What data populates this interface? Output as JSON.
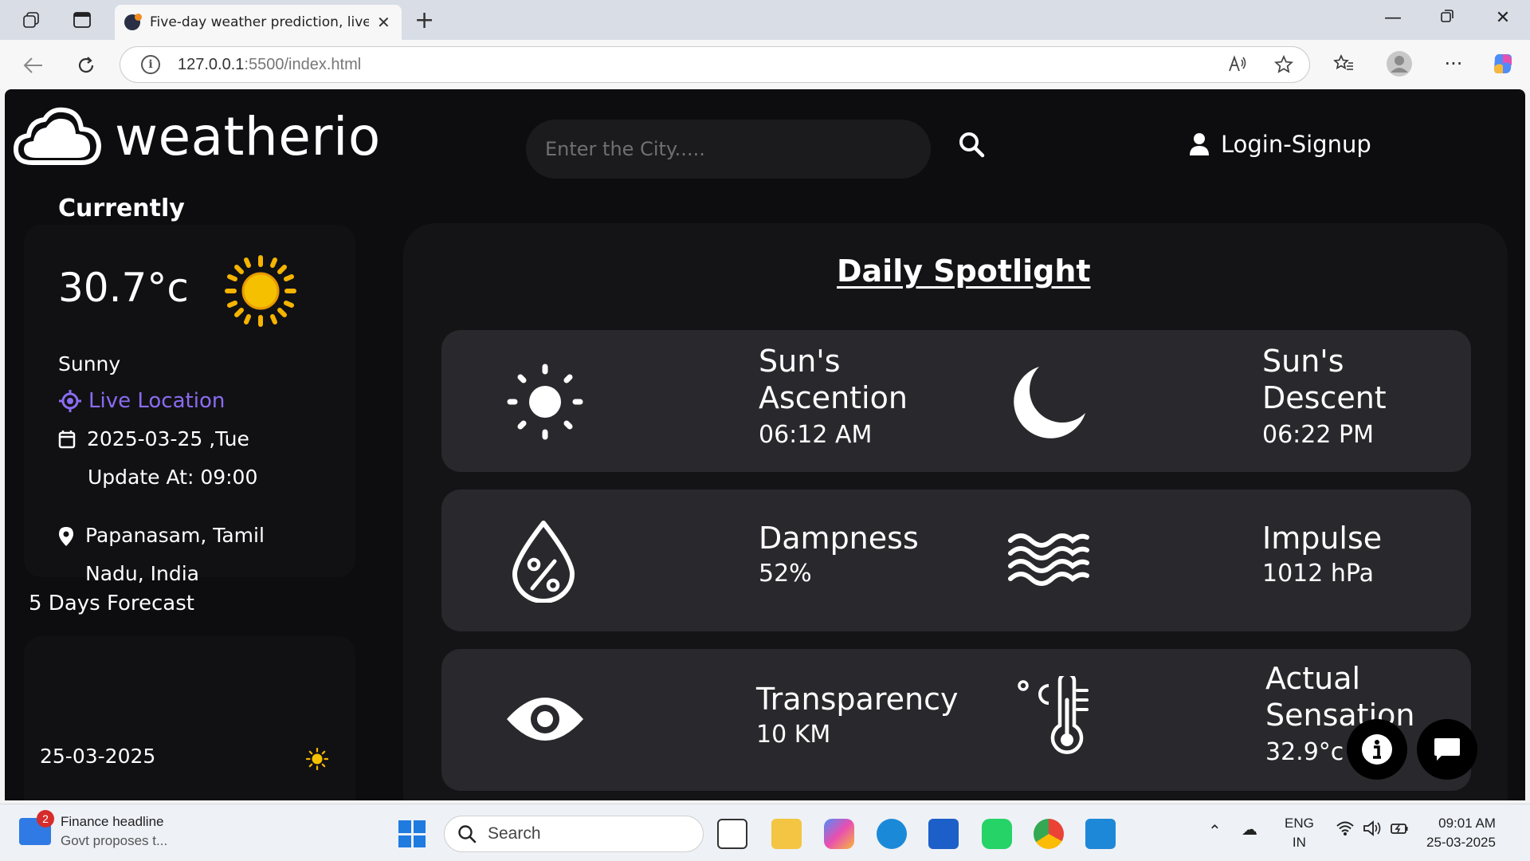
{
  "browser": {
    "tab_title": "Five-day weather prediction, live w",
    "url_host": "127.0.0.1",
    "url_path": ":5500/index.html"
  },
  "header": {
    "logo_text": "weatherio",
    "search_placeholder": "Enter the City.....",
    "login_label": "Login-Signup"
  },
  "current": {
    "title": "Currently",
    "temperature": "30.7°c",
    "condition": "Sunny",
    "live_location_label": "Live Location",
    "date": "2025-03-25 ,Tue",
    "update_at": "Update At: 09:00",
    "location": "Papanasam, Tamil Nadu, India"
  },
  "forecast": {
    "title": "5 Days Forecast",
    "items": [
      {
        "date": "25-03-2025",
        "icon": "sun-icon"
      }
    ]
  },
  "spotlight": {
    "title": "Daily Spotlight",
    "sunrise_label": "Sun's Ascention",
    "sunrise_value": "06:12 AM",
    "sunset_label": "Sun's Descent",
    "sunset_value": "06:22 PM",
    "humidity_label": "Dampness",
    "humidity_value": "52%",
    "pressure_label": "Impulse",
    "pressure_value": "1012 hPa",
    "visibility_label": "Transparency",
    "visibility_value": "10 KM",
    "feels_like_label": "Actual Sensation",
    "feels_like_value": "32.9°c"
  },
  "taskbar": {
    "news_title": "Finance headline",
    "news_sub": "Govt proposes t...",
    "news_badge": "2",
    "search_label": "Search",
    "lang_top": "ENG",
    "lang_bottom": "IN",
    "time": "09:01 AM",
    "date": "25-03-2025"
  },
  "colors": {
    "accent": "#8b6cf0",
    "page_bg": "#0d0d0f",
    "card_bg": "#29282c",
    "sun": "#f5b400"
  }
}
